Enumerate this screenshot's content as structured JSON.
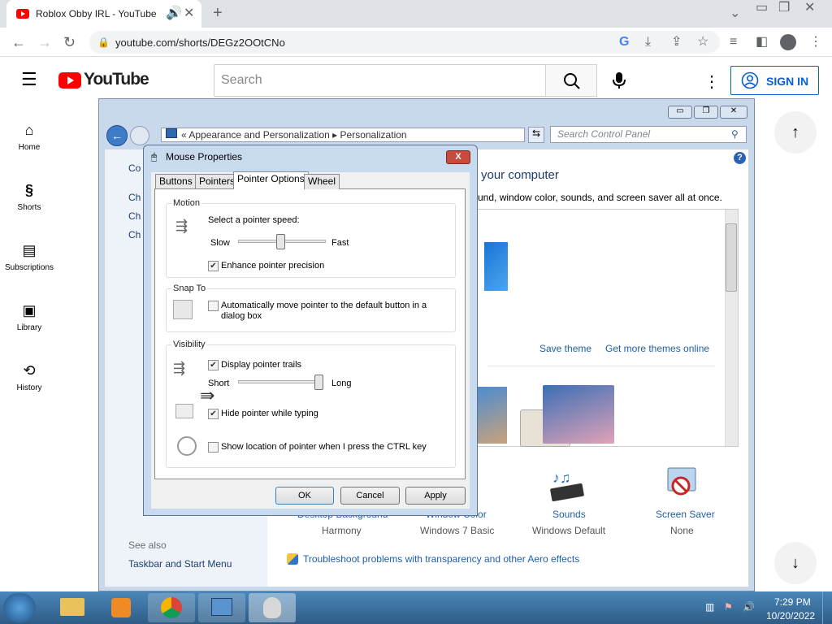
{
  "browser": {
    "tab_title": "Roblox Obby IRL - YouTube",
    "url": "youtube.com/shorts/DEGz2OOtCNo",
    "new_tab_symbol": "+"
  },
  "youtube": {
    "logo_text": "YouTube",
    "search_placeholder": "Search",
    "sign_in_label": "SIGN IN",
    "sidebar": [
      {
        "label": "Home",
        "icon": "home-icon"
      },
      {
        "label": "Shorts",
        "icon": "shorts-icon"
      },
      {
        "label": "Subscriptions",
        "icon": "subscriptions-icon"
      },
      {
        "label": "Library",
        "icon": "library-icon"
      },
      {
        "label": "History",
        "icon": "history-icon"
      }
    ]
  },
  "control_panel": {
    "breadcrumb_root": "Appearance and Personalization",
    "breadcrumb_current": "Personalization",
    "search_placeholder": "Search Control Panel",
    "left_partial": [
      "Co",
      "Ch",
      "Ch",
      "Ch"
    ],
    "heading_partial": "your computer",
    "subheading_partial": "und, window color, sounds, and screen saver all at once.",
    "save_theme": "Save theme",
    "get_more_themes": "Get more themes online",
    "bottom_items": [
      {
        "title": "Desktop Background",
        "value": "Harmony"
      },
      {
        "title": "Window Color",
        "value": "Windows 7 Basic"
      },
      {
        "title": "Sounds",
        "value": "Windows Default"
      },
      {
        "title": "Screen Saver",
        "value": "None"
      }
    ],
    "see_also": "See also",
    "taskbar_link": "Taskbar and Start Menu",
    "troubleshoot": "Troubleshoot problems with transparency and other Aero effects"
  },
  "mouse_dialog": {
    "title": "Mouse Properties",
    "close_symbol": "X",
    "tabs": [
      "Buttons",
      "Pointers",
      "Pointer Options",
      "Wheel"
    ],
    "active_tab": "Pointer Options",
    "motion": {
      "group_label": "Motion",
      "prompt": "Select a pointer speed:",
      "slow": "Slow",
      "fast": "Fast",
      "speed_level": 0.5,
      "enhance_label": "Enhance pointer precision",
      "enhance_checked": true
    },
    "snap_to": {
      "group_label": "Snap To",
      "auto_label_1": "Automatically move pointer to the default button in a",
      "auto_label_2": "dialog box",
      "auto_checked": false
    },
    "visibility": {
      "group_label": "Visibility",
      "trails_label": "Display pointer trails",
      "trails_checked": true,
      "short": "Short",
      "long": "Long",
      "trail_level": 1.0,
      "hide_label": "Hide pointer while typing",
      "hide_checked": true,
      "show_location_label": "Show location of pointer when I press the CTRL key",
      "show_location_checked": false
    },
    "buttons": {
      "ok": "OK",
      "cancel": "Cancel",
      "apply": "Apply"
    }
  },
  "taskbar": {
    "time": "7:29 PM",
    "date": "10/20/2022"
  }
}
